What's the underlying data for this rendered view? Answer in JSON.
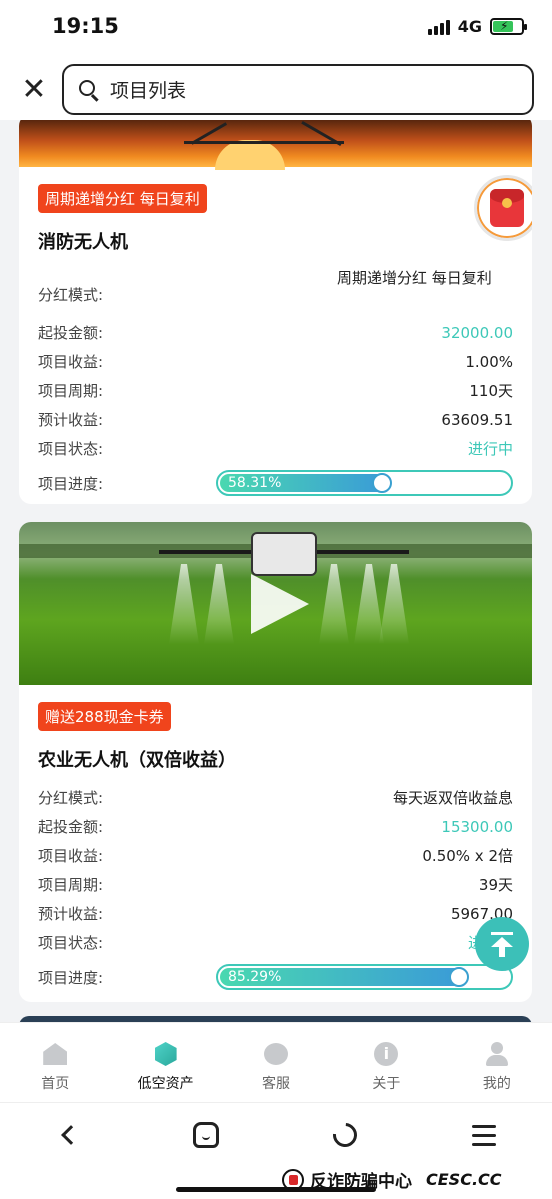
{
  "status_bar": {
    "time": "19:15",
    "network": "4G"
  },
  "header": {
    "search_text": "项目列表"
  },
  "projects": [
    {
      "tag": "周期递增分红 每日复利",
      "title": "消防无人机",
      "rows": [
        {
          "label": "分红模式:",
          "value": "周期递增分红  每日复利"
        },
        {
          "label": "起投金额:",
          "value": "32000.00"
        },
        {
          "label": "项目收益:",
          "value": "1.00%"
        },
        {
          "label": "项目周期:",
          "value": "110天"
        },
        {
          "label": "预计收益:",
          "value": "63609.51"
        },
        {
          "label": "项目状态:",
          "value": "进行中"
        }
      ],
      "progress_label": "项目进度:",
      "progress_text": "58.31%",
      "progress_fraction": 0.5831
    },
    {
      "tag": "赠送288现金卡券",
      "title": "农业无人机（双倍收益）",
      "rows": [
        {
          "label": "分红模式:",
          "value": "每天返双倍收益息"
        },
        {
          "label": "起投金额:",
          "value": "15300.00"
        },
        {
          "label": "项目收益:",
          "value": "0.50% x 2倍"
        },
        {
          "label": "项目周期:",
          "value": "39天"
        },
        {
          "label": "预计收益:",
          "value": "5967.00"
        },
        {
          "label": "项目状态:",
          "value": "进"
        }
      ],
      "progress_label": "项目进度:",
      "progress_text": "85.29%",
      "progress_fraction": 0.8529
    }
  ],
  "tabbar": [
    {
      "label": "首页",
      "icon": "home-icon"
    },
    {
      "label": "低空资产",
      "icon": "cube-icon",
      "active": true
    },
    {
      "label": "客服",
      "icon": "headset-icon"
    },
    {
      "label": "关于",
      "icon": "info-icon"
    },
    {
      "label": "我的",
      "icon": "user-icon"
    }
  ],
  "watermark": {
    "cn": "反诈防骗中心",
    "en": "CESC.CC"
  },
  "colors": {
    "accent_teal": "#3dc8b8",
    "tag_red": "#f0441c"
  }
}
